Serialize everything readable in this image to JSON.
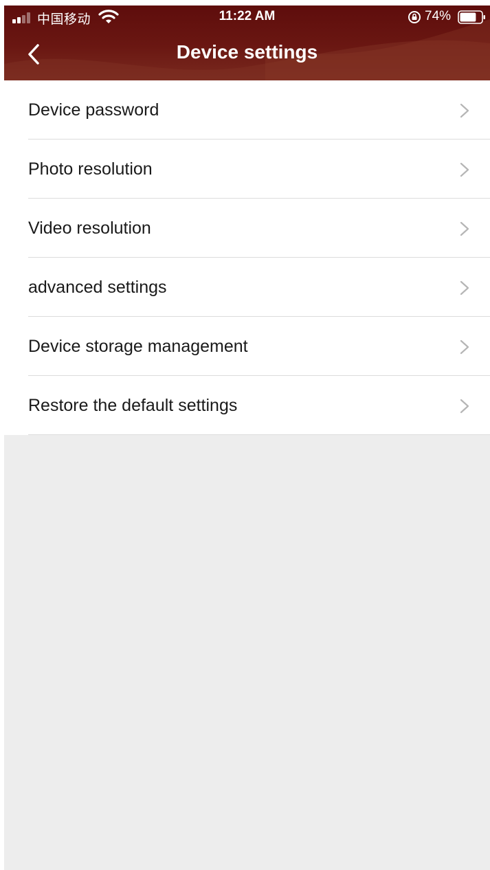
{
  "status_bar": {
    "carrier": "中国移动",
    "time": "11:22 AM",
    "battery_percent": "74%",
    "battery_level": 0.74,
    "signal_bars": 2,
    "icons": [
      "signal-icon",
      "wifi-icon",
      "rotation-lock-icon",
      "battery-icon"
    ]
  },
  "nav": {
    "title": "Device settings",
    "back_icon": "chevron-left-icon"
  },
  "menu": {
    "items": [
      {
        "label": "Device password"
      },
      {
        "label": "Photo resolution"
      },
      {
        "label": "Video resolution"
      },
      {
        "label": "advanced settings"
      },
      {
        "label": "Device storage management"
      },
      {
        "label": "Restore the default settings"
      }
    ],
    "chevron_icon": "chevron-right-icon"
  },
  "colors": {
    "header": "#6a1712",
    "background": "#ededed",
    "row_background": "#ffffff",
    "chevron": "#b5b5b5",
    "divider": "#dcdcdc"
  }
}
